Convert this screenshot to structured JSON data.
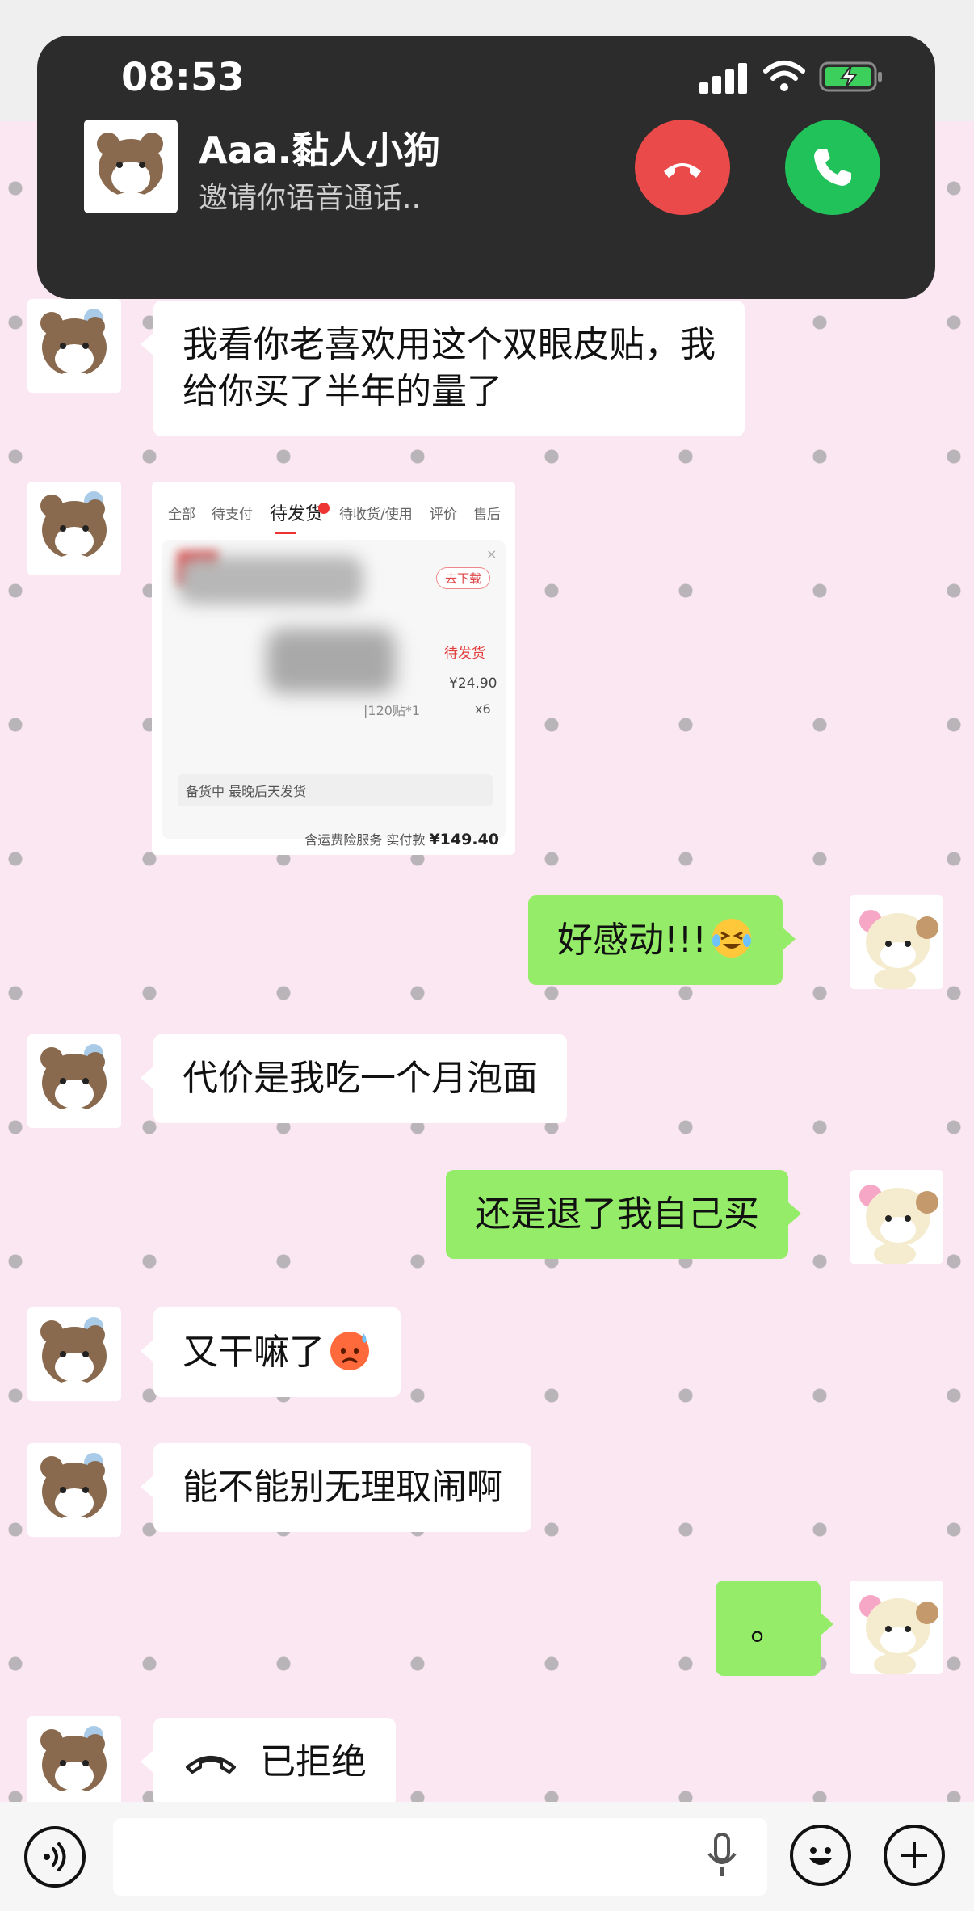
{
  "status_bar": {
    "time": "08:53"
  },
  "incoming_call": {
    "caller_name": "Aaa.黏人小狗",
    "subtitle": "邀请你语音通话.."
  },
  "messages": [
    {
      "side": "left",
      "text": "我看你老喜欢用这个双眼皮贴，我",
      "text2": "给你买了半年的量了"
    },
    {
      "side": "left",
      "type": "image"
    },
    {
      "side": "right",
      "text": "好感动!!!",
      "emoji": "crying-laughing-emoji"
    },
    {
      "side": "left",
      "text": "代价是我吃一个月泡面"
    },
    {
      "side": "right",
      "text": "还是退了我自己买"
    },
    {
      "side": "left",
      "text": "又干嘛了",
      "emoji": "angry-sweat-emoji"
    },
    {
      "side": "left",
      "text": "能不能别无理取闹啊"
    },
    {
      "side": "right",
      "text": "。"
    },
    {
      "side": "left",
      "type": "call",
      "text": "已拒绝"
    }
  ],
  "order_screenshot": {
    "tabs": [
      "全部",
      "待支付",
      "待发货",
      "待收货/使用",
      "评价",
      "售后"
    ],
    "active_tab": "待发货",
    "go_download": "去下载",
    "status": "待发货",
    "price": "¥24.90",
    "spec": "|120贴*1",
    "quantity": "x6",
    "shipping_note": "备货中  最晚后天发货",
    "total_prefix": "含运费险服务  实付款",
    "total": "¥149.40"
  },
  "colors": {
    "background": "#fbe7f1",
    "own_bubble": "#95ec69",
    "decline": "#ea4a4a",
    "accept": "#22c25a"
  }
}
